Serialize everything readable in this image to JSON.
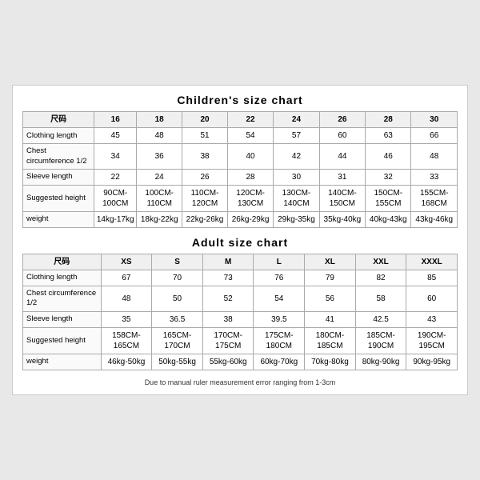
{
  "children_chart": {
    "title": "Children's size chart",
    "headers": [
      "尺码",
      "16",
      "18",
      "20",
      "22",
      "24",
      "26",
      "28",
      "30"
    ],
    "rows": [
      {
        "label": "Clothing length",
        "values": [
          "45",
          "48",
          "51",
          "54",
          "57",
          "60",
          "63",
          "66"
        ]
      },
      {
        "label": "Chest circumference 1/2",
        "values": [
          "34",
          "36",
          "38",
          "40",
          "42",
          "44",
          "46",
          "48"
        ]
      },
      {
        "label": "Sleeve length",
        "values": [
          "22",
          "24",
          "26",
          "28",
          "30",
          "31",
          "32",
          "33"
        ]
      },
      {
        "label": "Suggested height",
        "values": [
          "90CM-100CM",
          "100CM-110CM",
          "110CM-120CM",
          "120CM-130CM",
          "130CM-140CM",
          "140CM-150CM",
          "150CM-155CM",
          "155CM-168CM"
        ]
      },
      {
        "label": "weight",
        "values": [
          "14kg-17kg",
          "18kg-22kg",
          "22kg-26kg",
          "26kg-29kg",
          "29kg-35kg",
          "35kg-40kg",
          "40kg-43kg",
          "43kg-46kg"
        ]
      }
    ]
  },
  "adult_chart": {
    "title": "Adult size chart",
    "headers": [
      "尺码",
      "XS",
      "S",
      "M",
      "L",
      "XL",
      "XXL",
      "XXXL"
    ],
    "rows": [
      {
        "label": "Clothing length",
        "values": [
          "67",
          "70",
          "73",
          "76",
          "79",
          "82",
          "85"
        ]
      },
      {
        "label": "Chest circumference 1/2",
        "values": [
          "48",
          "50",
          "52",
          "54",
          "56",
          "58",
          "60"
        ]
      },
      {
        "label": "Sleeve length",
        "values": [
          "35",
          "36.5",
          "38",
          "39.5",
          "41",
          "42.5",
          "43"
        ]
      },
      {
        "label": "Suggested height",
        "values": [
          "158CM-165CM",
          "165CM-170CM",
          "170CM-175CM",
          "175CM-180CM",
          "180CM-185CM",
          "185CM-190CM",
          "190CM-195CM"
        ]
      },
      {
        "label": "weight",
        "values": [
          "46kg-50kg",
          "50kg-55kg",
          "55kg-60kg",
          "60kg-70kg",
          "70kg-80kg",
          "80kg-90kg",
          "90kg-95kg"
        ]
      }
    ]
  },
  "footer_note": "Due to manual ruler measurement error ranging from 1-3cm"
}
